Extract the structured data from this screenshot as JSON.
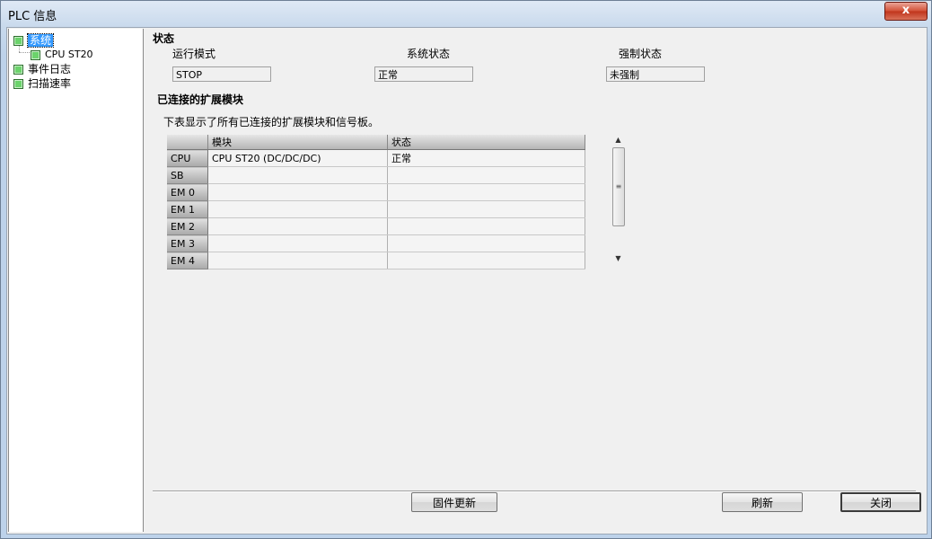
{
  "window": {
    "title": "PLC 信息",
    "close_label": "x"
  },
  "tree": {
    "items": [
      {
        "label": "系统",
        "selected": true
      },
      {
        "label": "CPU ST20"
      },
      {
        "label": "事件日志"
      },
      {
        "label": "扫描速率"
      }
    ]
  },
  "status": {
    "heading": "状态",
    "run_mode_label": "运行模式",
    "run_mode_value": "STOP",
    "system_status_label": "系统状态",
    "system_status_value": "正常",
    "force_status_label": "强制状态",
    "force_status_value": "未强制"
  },
  "modules": {
    "heading": "已连接的扩展模块",
    "description": "下表显示了所有已连接的扩展模块和信号板。",
    "columns": [
      "",
      "模块",
      "状态"
    ],
    "rows": [
      {
        "slot": "CPU",
        "module": "CPU ST20 (DC/DC/DC)",
        "status": "正常"
      },
      {
        "slot": "SB",
        "module": "",
        "status": ""
      },
      {
        "slot": "EM 0",
        "module": "",
        "status": ""
      },
      {
        "slot": "EM 1",
        "module": "",
        "status": ""
      },
      {
        "slot": "EM 2",
        "module": "",
        "status": ""
      },
      {
        "slot": "EM 3",
        "module": "",
        "status": ""
      },
      {
        "slot": "EM 4",
        "module": "",
        "status": ""
      }
    ]
  },
  "buttons": {
    "firmware_update": "固件更新",
    "refresh": "刷新",
    "close": "关闭"
  }
}
